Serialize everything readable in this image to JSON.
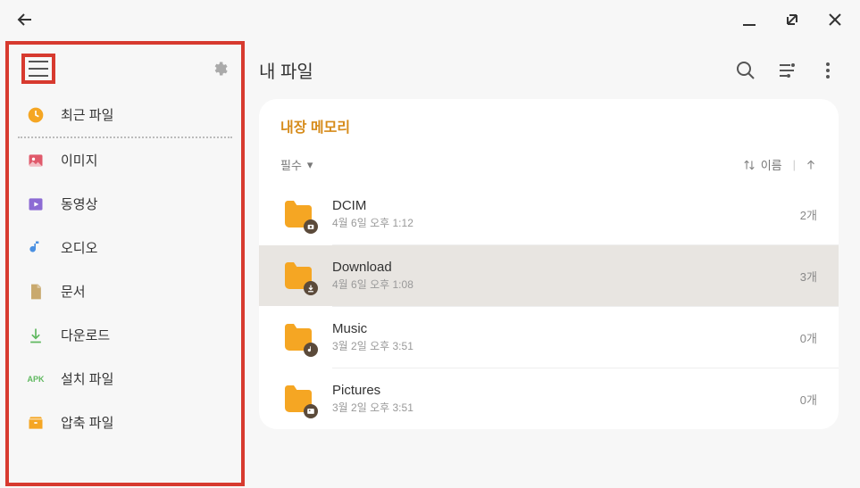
{
  "app": {
    "title": "내 파일"
  },
  "storage": {
    "title": "내장 메모리"
  },
  "filter": {
    "label": "필수"
  },
  "sort": {
    "label": "이름"
  },
  "sidebar": {
    "items": [
      {
        "label": "최근 파일",
        "icon": "clock",
        "color": "#f5a623"
      },
      {
        "label": "이미지",
        "icon": "image",
        "color": "#e05a6b"
      },
      {
        "label": "동영상",
        "icon": "video",
        "color": "#8c6bd4"
      },
      {
        "label": "오디오",
        "icon": "audio",
        "color": "#4a90e2"
      },
      {
        "label": "문서",
        "icon": "document",
        "color": "#c9a96e"
      },
      {
        "label": "다운로드",
        "icon": "download",
        "color": "#5fb85f"
      },
      {
        "label": "설치 파일",
        "icon": "apk",
        "color": "#5fb85f"
      },
      {
        "label": "압축 파일",
        "icon": "archive",
        "color": "#f5a623"
      }
    ]
  },
  "files": [
    {
      "name": "DCIM",
      "meta": "4월 6일 오후 1:12",
      "count": "2개",
      "badge": "camera"
    },
    {
      "name": "Download",
      "meta": "4월 6일 오후 1:08",
      "count": "3개",
      "badge": "download"
    },
    {
      "name": "Music",
      "meta": "3월 2일 오후 3:51",
      "count": "0개",
      "badge": "music"
    },
    {
      "name": "Pictures",
      "meta": "3월 2일 오후 3:51",
      "count": "0개",
      "badge": "image"
    }
  ]
}
